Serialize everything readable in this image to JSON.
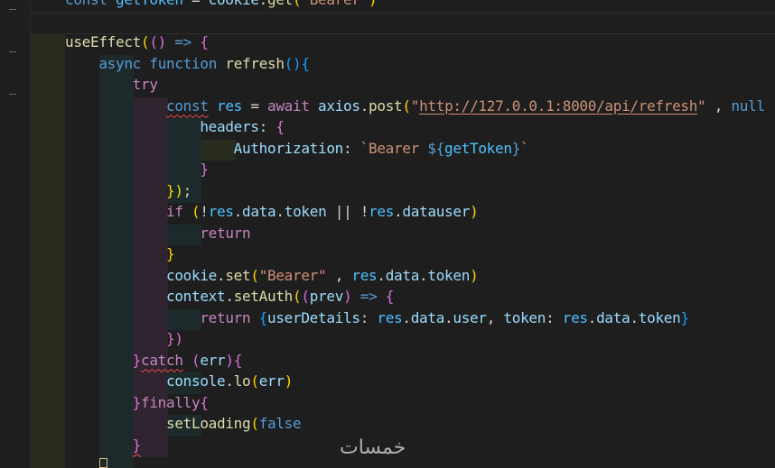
{
  "editor": {
    "colors": {
      "background": "#1e1e1e",
      "guide_level1": "#282c1f",
      "guide_level2": "#1c2a2b",
      "guide_level3": "#2f2430",
      "guide_level4": "#1c2a2b",
      "guide_level5": "#282c1f",
      "keyword": "#569cd6",
      "control": "#c586c0",
      "function": "#dcdcaa",
      "variable": "#9cdcfe",
      "constant": "#4fc1ff",
      "string": "#ce9178",
      "plain": "#d4d4d4",
      "bracket_gold": "#ffd700",
      "bracket_pink": "#da70d6",
      "bracket_blue": "#179fff"
    },
    "lines": [
      [
        [
          "const ",
          "#569cd6"
        ],
        [
          "getToken",
          "#4fc1ff"
        ],
        [
          " = ",
          "#d4d4d4"
        ],
        [
          "cookie",
          "#9cdcfe"
        ],
        [
          ".",
          "#d4d4d4"
        ],
        [
          "get",
          "#dcdcaa"
        ],
        [
          "(",
          "#ffd700"
        ],
        [
          "'Bearer'",
          "#ce9178"
        ],
        [
          ")",
          "#ffd700"
        ]
      ],
      [],
      [
        [
          "useEffect",
          "#dcdcaa"
        ],
        [
          "(",
          "#ffd700"
        ],
        [
          "() ",
          "#da70d6"
        ],
        [
          "=>",
          "#569cd6"
        ],
        [
          " ",
          "#d4d4d4"
        ],
        [
          "{",
          "#da70d6"
        ]
      ],
      [
        [
          "    "
        ],
        [
          "async",
          "#569cd6"
        ],
        [
          " ",
          "#d4d4d4"
        ],
        [
          "function",
          "#569cd6"
        ],
        [
          " ",
          "#d4d4d4"
        ],
        [
          "refresh",
          "#dcdcaa"
        ],
        [
          "()",
          "#179fff"
        ],
        [
          "{",
          "#179fff"
        ]
      ],
      [
        [
          "        "
        ],
        [
          "try",
          "#c586c0"
        ]
      ],
      [
        [
          "            "
        ],
        [
          "const",
          "#569cd6",
          "squig"
        ],
        [
          " ",
          "#d4d4d4"
        ],
        [
          "res",
          "#4fc1ff"
        ],
        [
          " = ",
          "#d4d4d4"
        ],
        [
          "await",
          "#c586c0"
        ],
        [
          " ",
          "#d4d4d4"
        ],
        [
          "axios",
          "#9cdcfe"
        ],
        [
          ".",
          "#d4d4d4"
        ],
        [
          "post",
          "#dcdcaa"
        ],
        [
          "(",
          "#ffd700"
        ],
        [
          "\"",
          "#ce9178"
        ],
        [
          "http://127.0.0.1:8000/api/refresh",
          "#ce9178",
          "url"
        ],
        [
          "\"",
          "#ce9178"
        ],
        [
          " , ",
          "#d4d4d4"
        ],
        [
          "null",
          "#569cd6"
        ]
      ],
      [
        [
          "                "
        ],
        [
          "headers",
          "#9cdcfe"
        ],
        [
          ": ",
          "#d4d4d4"
        ],
        [
          "{",
          "#da70d6"
        ]
      ],
      [
        [
          "                    "
        ],
        [
          "Authorization",
          "#9cdcfe"
        ],
        [
          ": ",
          "#d4d4d4"
        ],
        [
          "`Bearer ",
          "#ce9178"
        ],
        [
          "${",
          "#569cd6"
        ],
        [
          "getToken",
          "#4fc1ff"
        ],
        [
          "}",
          "#569cd6"
        ],
        [
          "`",
          "#ce9178"
        ]
      ],
      [
        [
          "                "
        ],
        [
          "}",
          "#da70d6"
        ]
      ],
      [
        [
          "            "
        ],
        [
          "})",
          "#ffd700"
        ],
        [
          ";",
          "#d4d4d4"
        ]
      ],
      [
        [
          "            "
        ],
        [
          "if",
          "#c586c0"
        ],
        [
          " ",
          "#d4d4d4"
        ],
        [
          "(",
          "#ffd700"
        ],
        [
          "!",
          "#d4d4d4"
        ],
        [
          "res",
          "#4fc1ff"
        ],
        [
          ".",
          "#d4d4d4"
        ],
        [
          "data",
          "#9cdcfe"
        ],
        [
          ".",
          "#d4d4d4"
        ],
        [
          "token",
          "#9cdcfe"
        ],
        [
          " || ",
          "#d4d4d4"
        ],
        [
          "!",
          "#d4d4d4"
        ],
        [
          "res",
          "#4fc1ff"
        ],
        [
          ".",
          "#d4d4d4"
        ],
        [
          "datauser",
          "#9cdcfe"
        ],
        [
          ")",
          "#ffd700"
        ]
      ],
      [
        [
          "                "
        ],
        [
          "return",
          "#c586c0"
        ]
      ],
      [
        [
          "            "
        ],
        [
          "}",
          "#ffd700"
        ]
      ],
      [
        [
          "            "
        ],
        [
          "cookie",
          "#9cdcfe"
        ],
        [
          ".",
          "#d4d4d4"
        ],
        [
          "set",
          "#dcdcaa"
        ],
        [
          "(",
          "#ffd700"
        ],
        [
          "\"Bearer\"",
          "#ce9178"
        ],
        [
          " , ",
          "#d4d4d4"
        ],
        [
          "res",
          "#4fc1ff"
        ],
        [
          ".",
          "#d4d4d4"
        ],
        [
          "data",
          "#9cdcfe"
        ],
        [
          ".",
          "#d4d4d4"
        ],
        [
          "token",
          "#9cdcfe"
        ],
        [
          ")",
          "#ffd700"
        ]
      ],
      [
        [
          "            "
        ],
        [
          "context",
          "#9cdcfe"
        ],
        [
          ".",
          "#d4d4d4"
        ],
        [
          "setAuth",
          "#dcdcaa"
        ],
        [
          "(",
          "#ffd700"
        ],
        [
          "(",
          "#da70d6"
        ],
        [
          "prev",
          "#9cdcfe"
        ],
        [
          ")",
          "#da70d6"
        ],
        [
          " ",
          "#d4d4d4"
        ],
        [
          "=>",
          "#569cd6"
        ],
        [
          " ",
          "#d4d4d4"
        ],
        [
          "{",
          "#da70d6"
        ]
      ],
      [
        [
          "                "
        ],
        [
          "return",
          "#c586c0"
        ],
        [
          " ",
          "#d4d4d4"
        ],
        [
          "{",
          "#179fff"
        ],
        [
          "userDetails",
          "#9cdcfe"
        ],
        [
          ": ",
          "#d4d4d4"
        ],
        [
          "res",
          "#4fc1ff"
        ],
        [
          ".",
          "#d4d4d4"
        ],
        [
          "data",
          "#9cdcfe"
        ],
        [
          ".",
          "#d4d4d4"
        ],
        [
          "user",
          "#9cdcfe"
        ],
        [
          ", ",
          "#d4d4d4"
        ],
        [
          "token",
          "#9cdcfe"
        ],
        [
          ": ",
          "#d4d4d4"
        ],
        [
          "res",
          "#4fc1ff"
        ],
        [
          ".",
          "#d4d4d4"
        ],
        [
          "data",
          "#9cdcfe"
        ],
        [
          ".",
          "#d4d4d4"
        ],
        [
          "token",
          "#9cdcfe"
        ],
        [
          "}",
          "#179fff"
        ]
      ],
      [
        [
          "            "
        ],
        [
          "})",
          "#da70d6"
        ]
      ],
      [
        [
          "        "
        ],
        [
          "}",
          "#da70d6"
        ],
        [
          "catch",
          "#c586c0",
          "squig"
        ],
        [
          " ",
          "#d4d4d4"
        ],
        [
          "(",
          "#da70d6"
        ],
        [
          "err",
          "#9cdcfe"
        ],
        [
          ")",
          "#da70d6"
        ],
        [
          "{",
          "#da70d6"
        ]
      ],
      [
        [
          "            "
        ],
        [
          "console",
          "#9cdcfe"
        ],
        [
          ".",
          "#d4d4d4"
        ],
        [
          "lo",
          "#dcdcaa"
        ],
        [
          "(",
          "#ffd700"
        ],
        [
          "err",
          "#9cdcfe"
        ],
        [
          ")",
          "#ffd700"
        ]
      ],
      [
        [
          "        "
        ],
        [
          "}",
          "#da70d6"
        ],
        [
          "finally",
          "#c586c0"
        ],
        [
          "{",
          "#da70d6"
        ]
      ],
      [
        [
          "            "
        ],
        [
          "setLoading",
          "#dcdcaa"
        ],
        [
          "(",
          "#ffd700"
        ],
        [
          "false",
          "#569cd6"
        ]
      ],
      [
        [
          "        "
        ],
        [
          "}",
          "#da70d6",
          "squig"
        ]
      ]
    ]
  },
  "watermark": {
    "text": "خمسات"
  }
}
